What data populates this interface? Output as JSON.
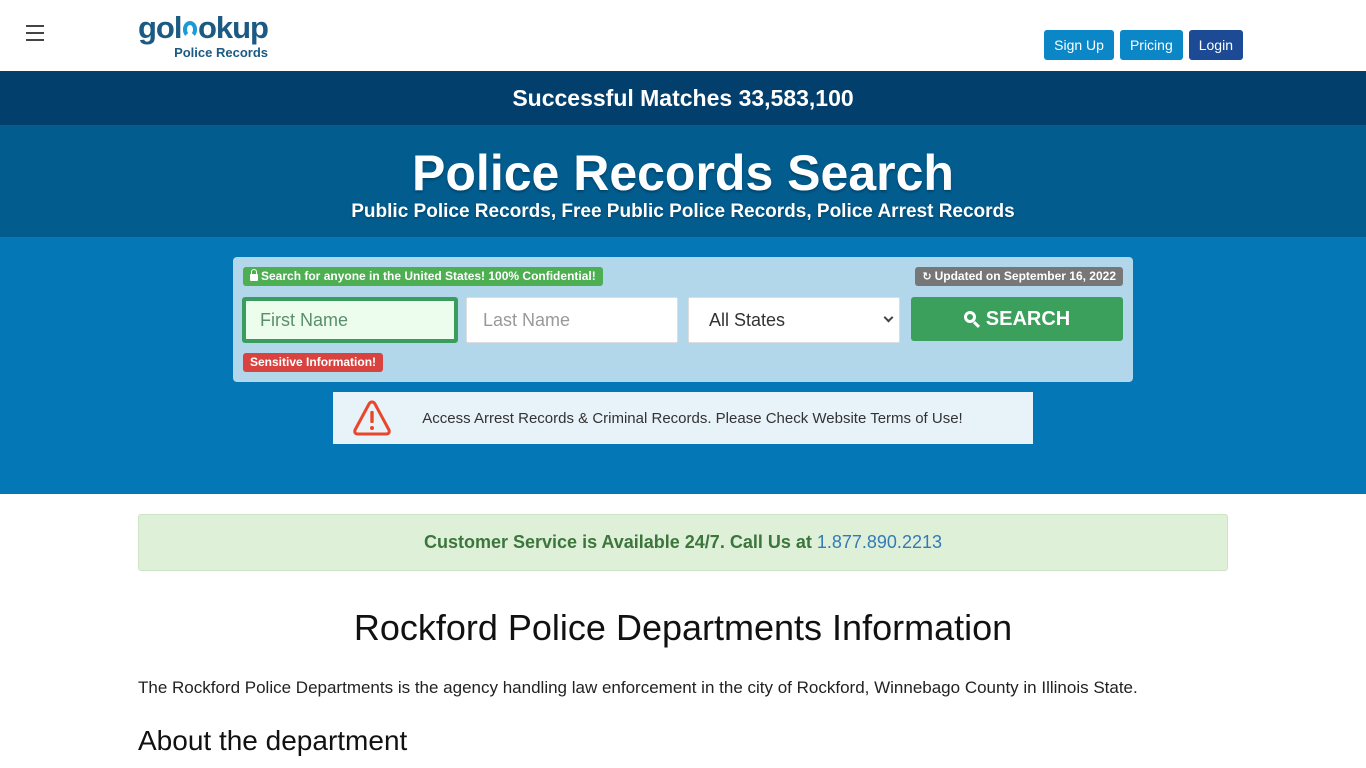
{
  "header": {
    "logo_main_pre": "gol",
    "logo_main_post": "okup",
    "logo_sub": "Police Records",
    "buttons": {
      "signup": "Sign Up",
      "pricing": "Pricing",
      "login": "Login"
    }
  },
  "matches": {
    "label": "Successful Matches 33,583,100"
  },
  "hero": {
    "title": "Police Records Search",
    "subtitle": "Public Police Records, Free Public Police Records, Police Arrest Records"
  },
  "search": {
    "badge_confidential": "Search for anyone in the United States! 100% Confidential!",
    "badge_updated": "Updated on September 16, 2022",
    "badge_sensitive": "Sensitive Information!",
    "first_name_placeholder": "First Name",
    "last_name_placeholder": "Last Name",
    "state_selected": "All States",
    "search_button": "SEARCH"
  },
  "notice": {
    "text": "Access Arrest Records & Criminal Records. Please Check Website Terms of Use!"
  },
  "service": {
    "text": "Customer Service is Available 24/7. Call Us at ",
    "phone": "1.877.890.2213"
  },
  "content": {
    "title": "Rockford Police Departments Information",
    "intro": "The Rockford Police Departments is the agency handling law enforcement in the city of Rockford, Winnebago County in Illinois State.",
    "section_heading": "About the department"
  },
  "colors": {
    "navy_banner": "#033f6c",
    "hero_bg": "#025c8e",
    "search_bg": "#0478b6",
    "search_button": "#3ba05c",
    "alert_red": "#d9433f"
  }
}
